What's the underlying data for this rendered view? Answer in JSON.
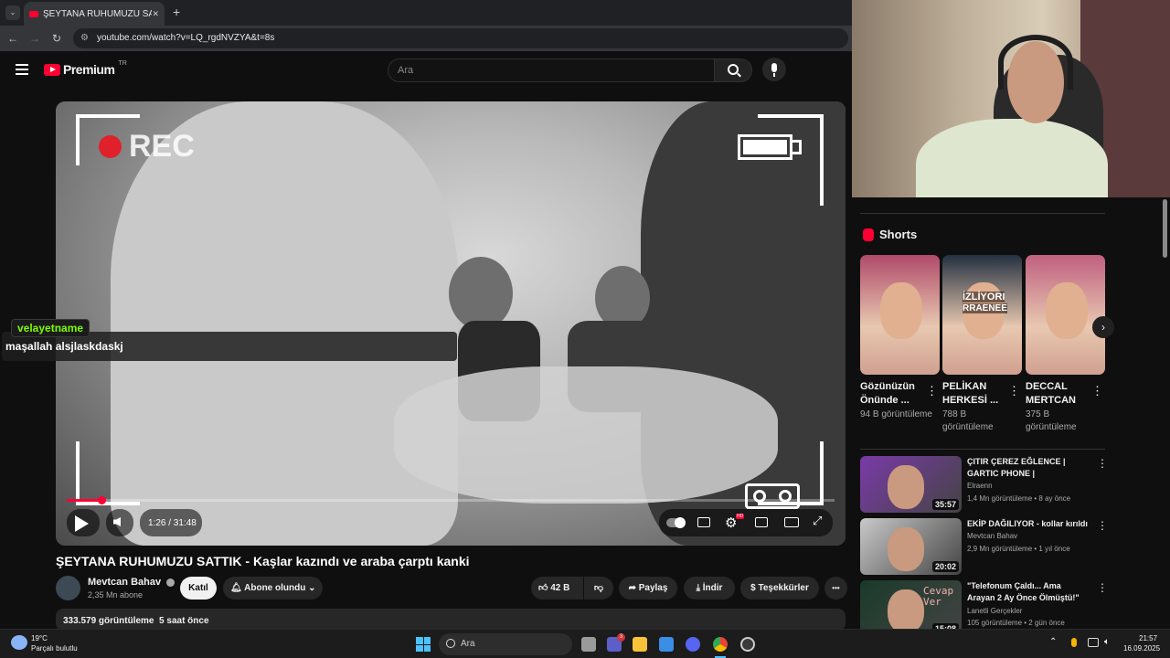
{
  "browser": {
    "tab_title": "ŞEYTANA RUHUMUZU SATTIK",
    "tab_close": "✕",
    "new_tab": "+",
    "url": "youtube.com/watch?v=LQ_rgdNVZYA&t=8s"
  },
  "youtube": {
    "logo_text": "Premium",
    "logo_badge": "TR",
    "search_placeholder": "Ara"
  },
  "player": {
    "rec_text": "REC",
    "time": "1:26 / 31:48",
    "progress_fraction": 0.045,
    "settings_badge": "HD"
  },
  "chat": {
    "username": "velayetname",
    "message": "maşallah alsjlaskdaskj"
  },
  "video": {
    "title": "ŞEYTANA RUHUMUZU SATTIK - Kaşlar kazındı ve araba çarptı kanki",
    "channel": "Mevtcan Bahav",
    "subscribers": "2,35 Mn abone",
    "join_label": "Katıl",
    "subscribed_label": "Abone olundu",
    "likes": "42 B",
    "share_label": "Paylaş",
    "download_label": "İndir",
    "thanks_label": "Teşekkürler",
    "more": "•••",
    "views_date": "333.579 görüntüleme  5 saat önce"
  },
  "shorts": {
    "heading": "Shorts",
    "items": [
      {
        "title": "Gözünüzün Önünde ...",
        "views": "94 B görüntüleme",
        "color": "#b04a6a"
      },
      {
        "title": "PELİKAN HERKESİ ...",
        "views": "788 B görüntüleme",
        "color": "#243040",
        "overlay1": "İZLİYORI",
        "overlay2": "RRAENEE"
      },
      {
        "title": "DECCAL MERTCAN",
        "views": "375 B görüntüleme",
        "color": "#c06080"
      }
    ]
  },
  "recommended": [
    {
      "title": "ÇITIR ÇEREZ EĞLENCE | GARTIC PHONE |",
      "channel": "Elraenn",
      "meta": "1,4 Mn görüntüleme • 8 ay önce",
      "duration": "35:57",
      "color": "#7a3aa8"
    },
    {
      "title": "EKİP DAĞILIYOR - kollar kırıldı",
      "channel": "Mevtcan Bahav",
      "meta": "2,9 Mn görüntüleme • 1 yıl önce",
      "duration": "20:02",
      "color": "#c9c9c9"
    },
    {
      "title": "\"Telefonum Çaldı... Ama Arayan 2 Ay Önce Ölmüştü!\"",
      "channel": "Lanetli Gerçekler",
      "meta": "105 görüntüleme • 2 gün önce",
      "duration": "15:08",
      "color": "#1a3a2a",
      "overlay": "Cevap Ver"
    }
  ],
  "taskbar": {
    "temperature": "19°C",
    "weather": "Parçalı bulutlu",
    "search": "Ara",
    "time": "21:57",
    "date": "16.09.2025",
    "teams_badge": "3"
  }
}
